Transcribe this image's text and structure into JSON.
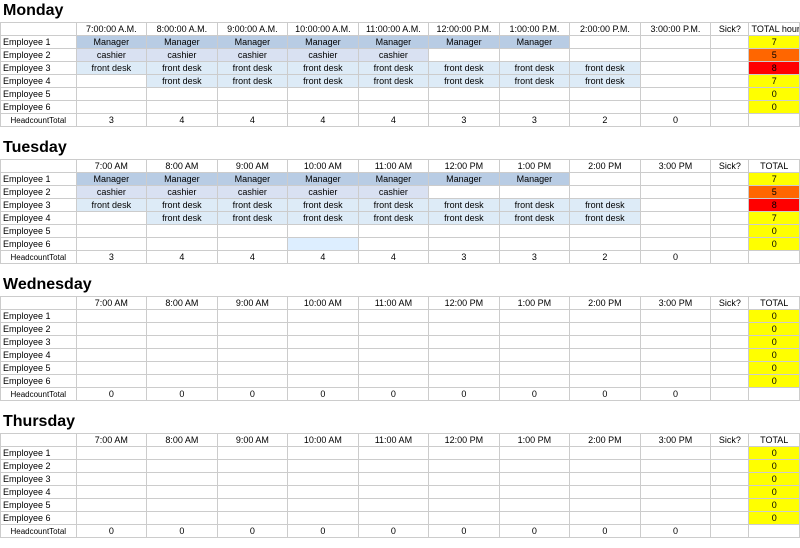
{
  "days": [
    {
      "name": "Monday",
      "headers": [
        "7:00:00 A.M.",
        "8:00:00 A.M.",
        "9:00:00 A.M.",
        "10:00:00 A.M.",
        "11:00:00 A.M.",
        "12:00:00 P.M.",
        "1:00:00 P.M.",
        "2:00:00 P.M.",
        "3:00:00 P.M.",
        "Sick?",
        "TOTAL hours worked"
      ],
      "employees": [
        {
          "name": "Employee 1",
          "shifts": [
            "Manager",
            "Manager",
            "Manager",
            "Manager",
            "Manager",
            "Manager",
            "Manager",
            "",
            ""
          ],
          "sick": "",
          "total": "7",
          "totalClass": "total-yellow"
        },
        {
          "name": "Employee 2",
          "shifts": [
            "cashier",
            "cashier",
            "cashier",
            "cashier",
            "cashier",
            "",
            "",
            "",
            ""
          ],
          "sick": "",
          "total": "5",
          "totalClass": "total-orange"
        },
        {
          "name": "Employee 3",
          "shifts": [
            "front desk",
            "front desk",
            "front desk",
            "front desk",
            "front desk",
            "front desk",
            "front desk",
            "front desk",
            ""
          ],
          "sick": "",
          "total": "8",
          "totalClass": "total-red"
        },
        {
          "name": "Employee 4",
          "shifts": [
            "",
            "front desk",
            "front desk",
            "front desk",
            "front desk",
            "front desk",
            "front desk",
            "front desk",
            ""
          ],
          "sick": "",
          "total": "7",
          "totalClass": "total-yellow"
        },
        {
          "name": "Employee 5",
          "shifts": [
            "",
            "",
            "",
            "",
            "",
            "",
            "",
            "",
            ""
          ],
          "sick": "",
          "total": "0",
          "totalClass": "total-yellow"
        },
        {
          "name": "Employee 6",
          "shifts": [
            "",
            "",
            "",
            "",
            "",
            "",
            "",
            "",
            ""
          ],
          "sick": "",
          "total": "0",
          "totalClass": "total-yellow"
        }
      ],
      "headcount": [
        "3",
        "4",
        "4",
        "4",
        "4",
        "3",
        "3",
        "2",
        "0",
        "",
        ""
      ],
      "headcountClasses": [
        "",
        "",
        "",
        "",
        "",
        "",
        "",
        "",
        "headcount-red",
        "",
        ""
      ]
    },
    {
      "name": "Tuesday",
      "headers": [
        "7:00 AM",
        "8:00 AM",
        "9:00 AM",
        "10:00 AM",
        "11:00 AM",
        "12:00 PM",
        "1:00 PM",
        "2:00 PM",
        "3:00 PM",
        "Sick?",
        "TOTAL"
      ],
      "employees": [
        {
          "name": "Employee 1",
          "shifts": [
            "Manager",
            "Manager",
            "Manager",
            "Manager",
            "Manager",
            "Manager",
            "Manager",
            "",
            ""
          ],
          "sick": "",
          "total": "7",
          "totalClass": "total-yellow"
        },
        {
          "name": "Employee 2",
          "shifts": [
            "cashier",
            "cashier",
            "cashier",
            "cashier",
            "cashier",
            "",
            "",
            "",
            ""
          ],
          "sick": "",
          "total": "5",
          "totalClass": "total-orange"
        },
        {
          "name": "Employee 3",
          "shifts": [
            "front desk",
            "front desk",
            "front desk",
            "front desk",
            "front desk",
            "front desk",
            "front desk",
            "front desk",
            ""
          ],
          "sick": "",
          "total": "8",
          "totalClass": "total-red"
        },
        {
          "name": "Employee 4",
          "shifts": [
            "",
            "front desk",
            "front desk",
            "front desk",
            "front desk",
            "front desk",
            "front desk",
            "front desk",
            ""
          ],
          "sick": "",
          "total": "7",
          "totalClass": "total-yellow"
        },
        {
          "name": "Employee 5",
          "shifts": [
            "",
            "",
            "",
            "",
            "",
            "",
            "",
            "",
            ""
          ],
          "sick": "",
          "total": "0",
          "totalClass": "total-yellow"
        },
        {
          "name": "Employee 6",
          "shifts": [
            "",
            "",
            "",
            "light blue",
            "",
            "",
            "",
            "",
            ""
          ],
          "sick": "",
          "total": "0",
          "totalClass": "total-yellow"
        }
      ],
      "headcount": [
        "3",
        "4",
        "4",
        "4",
        "4",
        "3",
        "3",
        "2",
        "0",
        "",
        ""
      ],
      "headcountClasses": [
        "",
        "",
        "",
        "",
        "",
        "",
        "",
        "",
        "",
        "",
        ""
      ]
    },
    {
      "name": "Wednesday",
      "headers": [
        "7:00 AM",
        "8:00 AM",
        "9:00 AM",
        "10:00 AM",
        "11:00 AM",
        "12:00 PM",
        "1:00 PM",
        "2:00 PM",
        "3:00 PM",
        "Sick?",
        "TOTAL"
      ],
      "employees": [
        {
          "name": "Employee 1",
          "shifts": [
            "",
            "",
            "",
            "",
            "",
            "",
            "",
            "",
            ""
          ],
          "sick": "",
          "total": "0",
          "totalClass": "total-yellow"
        },
        {
          "name": "Employee 2",
          "shifts": [
            "",
            "",
            "",
            "",
            "",
            "",
            "",
            "",
            ""
          ],
          "sick": "",
          "total": "0",
          "totalClass": "total-yellow"
        },
        {
          "name": "Employee 3",
          "shifts": [
            "",
            "",
            "",
            "",
            "",
            "",
            "",
            "",
            ""
          ],
          "sick": "",
          "total": "0",
          "totalClass": "total-yellow"
        },
        {
          "name": "Employee 4",
          "shifts": [
            "",
            "",
            "",
            "",
            "",
            "",
            "",
            "",
            ""
          ],
          "sick": "",
          "total": "0",
          "totalClass": "total-yellow"
        },
        {
          "name": "Employee 5",
          "shifts": [
            "",
            "",
            "",
            "",
            "",
            "",
            "",
            "",
            ""
          ],
          "sick": "",
          "total": "0",
          "totalClass": "total-yellow"
        },
        {
          "name": "Employee 6",
          "shifts": [
            "",
            "",
            "",
            "",
            "",
            "",
            "",
            "",
            ""
          ],
          "sick": "",
          "total": "0",
          "totalClass": "total-yellow"
        }
      ],
      "headcount": [
        "0",
        "0",
        "0",
        "0",
        "0",
        "0",
        "0",
        "0",
        "0",
        "",
        ""
      ],
      "headcountClasses": [
        "headcount-red",
        "headcount-green",
        "headcount-red",
        "headcount-red",
        "headcount-red",
        "headcount-red",
        "headcount-red",
        "headcount-red",
        "headcount-red",
        "",
        ""
      ]
    },
    {
      "name": "Thursday",
      "headers": [
        "7:00 AM",
        "8:00 AM",
        "9:00 AM",
        "10:00 AM",
        "11:00 AM",
        "12:00 PM",
        "1:00 PM",
        "2:00 PM",
        "3:00 PM",
        "Sick?",
        "TOTAL"
      ],
      "employees": [
        {
          "name": "Employee 1",
          "shifts": [
            "",
            "",
            "",
            "",
            "",
            "",
            "",
            "",
            ""
          ],
          "sick": "",
          "total": "0",
          "totalClass": "total-yellow"
        },
        {
          "name": "Employee 2",
          "shifts": [
            "",
            "",
            "",
            "",
            "",
            "",
            "",
            "",
            ""
          ],
          "sick": "",
          "total": "0",
          "totalClass": "total-yellow"
        },
        {
          "name": "Employee 3",
          "shifts": [
            "",
            "",
            "",
            "",
            "",
            "",
            "",
            "",
            ""
          ],
          "sick": "",
          "total": "0",
          "totalClass": "total-yellow"
        },
        {
          "name": "Employee 4",
          "shifts": [
            "",
            "",
            "",
            "",
            "",
            "",
            "",
            "",
            ""
          ],
          "sick": "",
          "total": "0",
          "totalClass": "total-yellow"
        },
        {
          "name": "Employee 5",
          "shifts": [
            "",
            "",
            "",
            "",
            "",
            "",
            "",
            "",
            ""
          ],
          "sick": "",
          "total": "0",
          "totalClass": "total-yellow"
        },
        {
          "name": "Employee 6",
          "shifts": [
            "",
            "",
            "",
            "",
            "",
            "",
            "",
            "",
            ""
          ],
          "sick": "",
          "total": "0",
          "totalClass": "total-yellow"
        }
      ],
      "headcount": [
        "0",
        "0",
        "0",
        "0",
        "0",
        "0",
        "0",
        "0",
        "0",
        "",
        ""
      ],
      "headcountClasses": [
        "headcount-red",
        "headcount-red",
        "headcount-red",
        "headcount-red",
        "headcount-red",
        "headcount-red",
        "headcount-red",
        "headcount-red",
        "headcount-red",
        "",
        ""
      ]
    }
  ]
}
